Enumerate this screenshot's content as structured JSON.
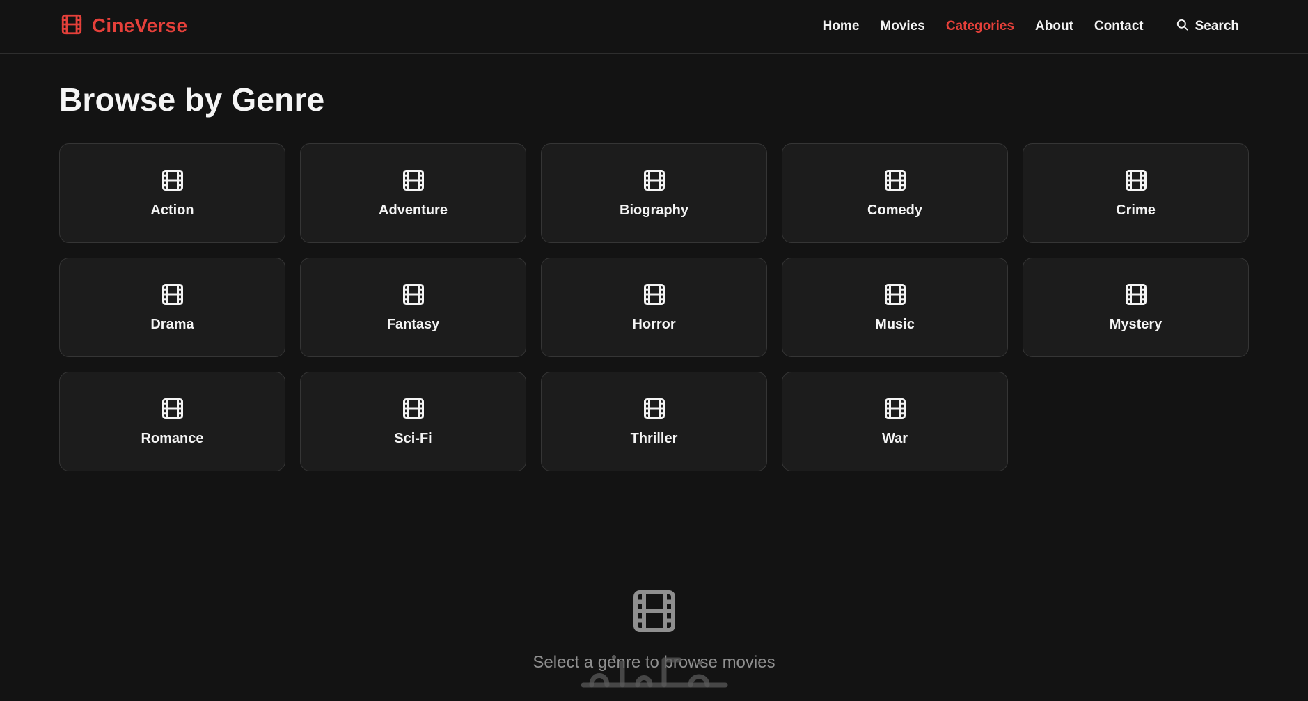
{
  "brand": {
    "name": "CineVerse",
    "icon": "film-icon",
    "color": "#e5403a"
  },
  "nav": {
    "items": [
      {
        "label": "Home",
        "active": false
      },
      {
        "label": "Movies",
        "active": false
      },
      {
        "label": "Categories",
        "active": true
      },
      {
        "label": "About",
        "active": false
      },
      {
        "label": "Contact",
        "active": false
      }
    ],
    "search_label": "Search",
    "search_icon": "search-icon"
  },
  "page": {
    "title": "Browse by Genre"
  },
  "genres": [
    {
      "label": "Action",
      "icon": "film-icon"
    },
    {
      "label": "Adventure",
      "icon": "film-icon"
    },
    {
      "label": "Biography",
      "icon": "film-icon"
    },
    {
      "label": "Comedy",
      "icon": "film-icon"
    },
    {
      "label": "Crime",
      "icon": "film-icon"
    },
    {
      "label": "Drama",
      "icon": "film-icon"
    },
    {
      "label": "Fantasy",
      "icon": "film-icon"
    },
    {
      "label": "Horror",
      "icon": "film-icon"
    },
    {
      "label": "Music",
      "icon": "film-icon"
    },
    {
      "label": "Mystery",
      "icon": "film-icon"
    },
    {
      "label": "Romance",
      "icon": "film-icon"
    },
    {
      "label": "Sci-Fi",
      "icon": "film-icon"
    },
    {
      "label": "Thriller",
      "icon": "film-icon"
    },
    {
      "label": "War",
      "icon": "film-icon"
    }
  ],
  "empty_state": {
    "icon": "film-icon",
    "text": "Select a genre to browse movies"
  },
  "watermark": {
    "icon": "watermark-logo"
  },
  "colors": {
    "background": "#131313",
    "card": "#1c1c1c",
    "card_border": "#353535",
    "accent": "#e5403a",
    "muted_text": "#8f8f8f"
  }
}
